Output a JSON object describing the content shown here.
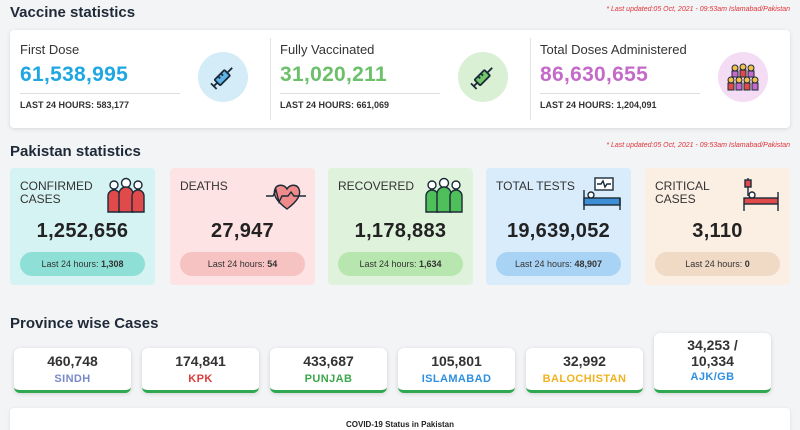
{
  "vaccine": {
    "title": "Vaccine statistics",
    "updated": "* Last updated:05 Oct, 2021 - 09:53am Islamabad/Pakistan",
    "items": [
      {
        "label": "First Dose",
        "value": "61,538,995",
        "sub": "LAST 24 HOURS: 583,177",
        "color": "#1ea7e1",
        "icon": "syringe-icon"
      },
      {
        "label": "Fully Vaccinated",
        "value": "31,020,211",
        "sub": "LAST 24 HOURS: 661,069",
        "color": "#6cc06a",
        "icon": "syringe-icon"
      },
      {
        "label": "Total Doses Administered",
        "value": "86,630,655",
        "sub": "LAST 24 HOURS: 1,204,091",
        "color": "#c46ac9",
        "icon": "crowd-icon"
      }
    ]
  },
  "pakistan": {
    "title": "Pakistan statistics",
    "updated": "* Last updated:05 Oct, 2021 - 09:53am Islamabad/Pakistan",
    "pill_prefix": "Last 24 hours:",
    "items": [
      {
        "label": "CONFIRMED CASES",
        "value": "1,252,656",
        "last24": "1,308",
        "bg": "#d6f3f3",
        "pill": "#8ee0d6",
        "icon": "people-icon"
      },
      {
        "label": "DEATHS",
        "value": "27,947",
        "last24": "54",
        "bg": "#fde3e3",
        "pill": "#f7c2c2",
        "icon": "heartbeat-icon"
      },
      {
        "label": "RECOVERED",
        "value": "1,178,883",
        "last24": "1,634",
        "bg": "#dff3dc",
        "pill": "#b7e6ae",
        "icon": "recovered-people-icon"
      },
      {
        "label": "TOTAL TESTS",
        "value": "19,639,052",
        "last24": "48,907",
        "bg": "#d9ecfb",
        "pill": "#a9d3f4",
        "icon": "hospital-bed-monitor-icon"
      },
      {
        "label": "CRITICAL CASES",
        "value": "3,110",
        "last24": "0",
        "bg": "#fbeee2",
        "pill": "#f0d9c5",
        "icon": "hospital-bed-icon"
      }
    ]
  },
  "provinces": {
    "title": "Province wise Cases",
    "items": [
      {
        "name": "SINDH",
        "value": "460,748",
        "color": "#7a8ac8"
      },
      {
        "name": "KPK",
        "value": "174,841",
        "color": "#e03b3b"
      },
      {
        "name": "PUNJAB",
        "value": "433,687",
        "color": "#3aa84a"
      },
      {
        "name": "ISLAMABAD",
        "value": "105,801",
        "color": "#2f8fe0"
      },
      {
        "name": "BALOCHISTAN",
        "value": "32,992",
        "color": "#f0b21f"
      },
      {
        "name": "AJK/GB",
        "value": "34,253 / 10,334",
        "color": "#2f8fe0"
      }
    ]
  },
  "bottom": {
    "title": "COVID-19 Status in Pakistan"
  }
}
